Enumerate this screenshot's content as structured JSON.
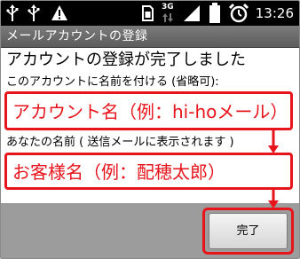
{
  "status_bar": {
    "time": "13:26",
    "network_label": "3G",
    "icons": [
      "usb-icon",
      "usb-icon",
      "warning-icon",
      "sim-icon",
      "signal-icon",
      "battery-icon",
      "alarm-icon"
    ]
  },
  "title_bar": {
    "title": "メールアカウントの登録"
  },
  "main": {
    "heading": "アカウントの登録が完了しました",
    "account_name_label": "このアカウントに名前を付ける (省略可):",
    "account_name_value": "アカウント名（例：hi-hoメール）",
    "your_name_label": "あなたの名前 ( 送信メールに表示されます )",
    "your_name_value": "お客様名（例：配穂太郎）"
  },
  "footer": {
    "done_label": "完了"
  },
  "colors": {
    "highlight": "#e8141c",
    "status_bar": "#000000",
    "title_bar": "#6b6b6b",
    "bottom_bar": "#9c9c9c"
  }
}
